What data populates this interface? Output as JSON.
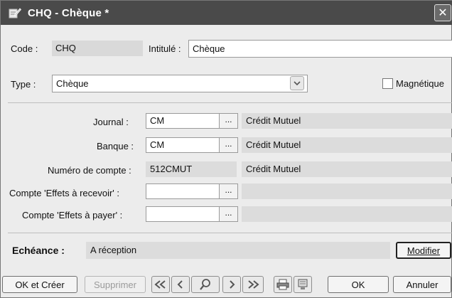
{
  "window": {
    "title": "CHQ - Chèque *",
    "close_symbol": "✕",
    "icon": "edit-document-icon"
  },
  "header": {
    "code_label": "Code :",
    "code_value": "CHQ",
    "intitule_label": "Intitulé :",
    "intitule_value": "Chèque",
    "type_label": "Type :",
    "type_value": "Chèque",
    "magnetique_label": "Magnétique",
    "magnetique_checked": false
  },
  "accounts": {
    "journal_label": "Journal :",
    "journal_value": "CM",
    "journal_name": "Crédit Mutuel",
    "banque_label": "Banque :",
    "banque_value": "CM",
    "banque_name": "Crédit Mutuel",
    "numero_label": "Numéro de compte :",
    "numero_value": "512CMUT",
    "numero_name": "Crédit Mutuel",
    "effets_recevoir_label": "Compte 'Effets à recevoir' :",
    "effets_recevoir_value": "",
    "effets_payer_label": "Compte 'Effets à payer' :",
    "effets_payer_value": "",
    "browse_symbol": "..."
  },
  "echeance": {
    "label": "Echéance :",
    "value": "A réception",
    "modifier_label": "Modifier"
  },
  "footer": {
    "ok_creer_label": "OK et Créer",
    "supprimer_label": "Supprimer",
    "ok_label": "OK",
    "annuler_label": "Annuler"
  }
}
